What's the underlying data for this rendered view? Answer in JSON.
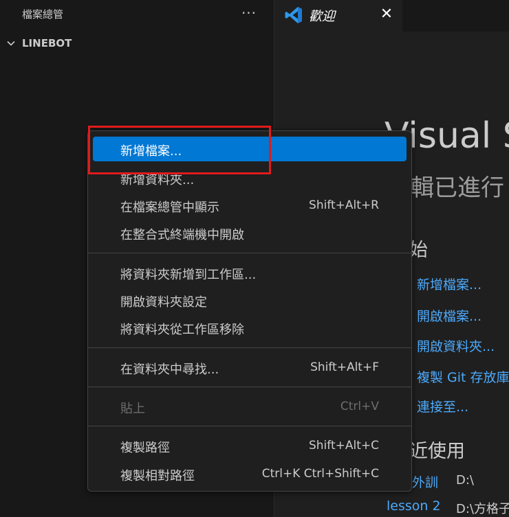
{
  "explorer": {
    "title": "檔案總管",
    "more_icon": "ellipsis-icon",
    "folder": {
      "name": "LINEBOT",
      "chevron_icon": "chevron-down-icon"
    }
  },
  "editor": {
    "tab": {
      "label": "歡迎",
      "icon": "vscode-icon",
      "close_icon": "close-icon"
    },
    "welcome": {
      "title": "Visual S",
      "subtitle": "輯已進行",
      "start_heading": "始",
      "links": [
        "新增檔案...",
        "開啟檔案...",
        "開啟資料夾...",
        "複製 Git 存放庫",
        "連接至..."
      ],
      "recent_heading": "近使用",
      "recent": [
        {
          "name": "外訓",
          "path": "D:\\"
        },
        {
          "name": "lesson 2",
          "path": "D:\\方格子"
        }
      ]
    }
  },
  "context_menu": {
    "groups": [
      [
        {
          "label": "新增檔案...",
          "shortcut": "",
          "active": true
        },
        {
          "label": "新增資料夾...",
          "shortcut": ""
        },
        {
          "label": "在檔案總管中顯示",
          "shortcut": "Shift+Alt+R"
        },
        {
          "label": "在整合式終端機中開啟",
          "shortcut": ""
        }
      ],
      [
        {
          "label": "將資料夾新增到工作區...",
          "shortcut": ""
        },
        {
          "label": "開啟資料夾設定",
          "shortcut": ""
        },
        {
          "label": "將資料夾從工作區移除",
          "shortcut": ""
        }
      ],
      [
        {
          "label": "在資料夾中尋找...",
          "shortcut": "Shift+Alt+F"
        }
      ],
      [
        {
          "label": "貼上",
          "shortcut": "Ctrl+V",
          "disabled": true
        }
      ],
      [
        {
          "label": "複製路徑",
          "shortcut": "Shift+Alt+C"
        },
        {
          "label": "複製相對路徑",
          "shortcut": "Ctrl+K Ctrl+Shift+C"
        }
      ]
    ]
  },
  "colors": {
    "accent": "#0078d4",
    "link": "#4daafc",
    "highlight_box": "#e11b1b"
  }
}
